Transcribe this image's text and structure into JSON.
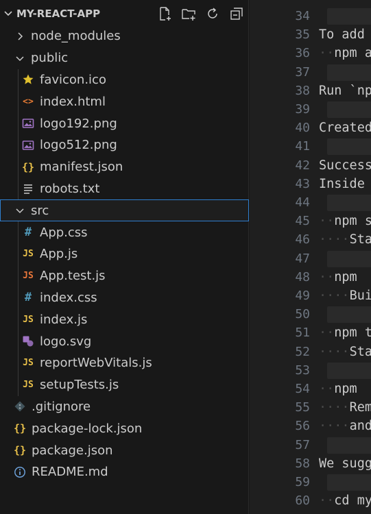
{
  "explorer": {
    "project_title": "MY-REACT-APP",
    "actions": [
      {
        "name": "new-file-icon",
        "title": "New File"
      },
      {
        "name": "new-folder-icon",
        "title": "New Folder"
      },
      {
        "name": "refresh-icon",
        "title": "Refresh Explorer"
      },
      {
        "name": "collapse-all-icon",
        "title": "Collapse Folders in Explorer"
      }
    ],
    "items": [
      {
        "label": "node_modules",
        "type": "folder-collapsed",
        "level": 0
      },
      {
        "label": "public",
        "type": "folder-expanded",
        "level": 0
      },
      {
        "label": "favicon.ico",
        "type": "file",
        "icon": "star-icon",
        "level": 1
      },
      {
        "label": "index.html",
        "type": "file",
        "icon": "html-icon",
        "level": 1
      },
      {
        "label": "logo192.png",
        "type": "file",
        "icon": "image-icon",
        "level": 1
      },
      {
        "label": "logo512.png",
        "type": "file",
        "icon": "image-icon",
        "level": 1
      },
      {
        "label": "manifest.json",
        "type": "file",
        "icon": "json-icon",
        "level": 1
      },
      {
        "label": "robots.txt",
        "type": "file",
        "icon": "text-lines-icon",
        "level": 1
      },
      {
        "label": "src",
        "type": "folder-expanded",
        "level": 0,
        "selected": true
      },
      {
        "label": "App.css",
        "type": "file",
        "icon": "css-hash-icon",
        "level": 1
      },
      {
        "label": "App.js",
        "type": "file",
        "icon": "js-icon",
        "level": 1
      },
      {
        "label": "App.test.js",
        "type": "file",
        "icon": "js-test-icon",
        "level": 1
      },
      {
        "label": "index.css",
        "type": "file",
        "icon": "css-hash-icon",
        "level": 1
      },
      {
        "label": "index.js",
        "type": "file",
        "icon": "js-icon",
        "level": 1
      },
      {
        "label": "logo.svg",
        "type": "file",
        "icon": "svg-icon",
        "level": 1
      },
      {
        "label": "reportWebVitals.js",
        "type": "file",
        "icon": "js-icon",
        "level": 1
      },
      {
        "label": "setupTests.js",
        "type": "file",
        "icon": "js-icon",
        "level": 1
      },
      {
        "label": ".gitignore",
        "type": "file",
        "icon": "git-icon",
        "level": 0
      },
      {
        "label": "package-lock.json",
        "type": "file",
        "icon": "json-icon",
        "level": 0
      },
      {
        "label": "package.json",
        "type": "file",
        "icon": "json-icon",
        "level": 0
      },
      {
        "label": "README.md",
        "type": "file",
        "icon": "info-icon",
        "level": 0
      }
    ],
    "glyphs": {
      "js": "JS",
      "json": "{}",
      "css": "#",
      "html": "<>"
    }
  },
  "editor": {
    "lines": [
      {
        "n": "34",
        "text": "",
        "blank_block": true
      },
      {
        "n": "35",
        "text": "To add"
      },
      {
        "n": "36",
        "text": "··npm a"
      },
      {
        "n": "37",
        "text": "",
        "blank_block": true
      },
      {
        "n": "38",
        "text": "Run `np"
      },
      {
        "n": "39",
        "text": "",
        "blank_block": true
      },
      {
        "n": "40",
        "text": "Created"
      },
      {
        "n": "41",
        "text": "",
        "blank_block": true
      },
      {
        "n": "42",
        "text": "Success"
      },
      {
        "n": "43",
        "text": "Inside"
      },
      {
        "n": "44",
        "text": "",
        "blank_block": true
      },
      {
        "n": "45",
        "text": "··npm s"
      },
      {
        "n": "46",
        "text": "····Sta"
      },
      {
        "n": "47",
        "text": "",
        "blank_block": true
      },
      {
        "n": "48",
        "text": "··npm"
      },
      {
        "n": "49",
        "text": "····Bui"
      },
      {
        "n": "50",
        "text": "",
        "blank_block": true
      },
      {
        "n": "51",
        "text": "··npm t"
      },
      {
        "n": "52",
        "text": "····Sta"
      },
      {
        "n": "53",
        "text": "",
        "blank_block": true
      },
      {
        "n": "54",
        "text": "··npm"
      },
      {
        "n": "55",
        "text": "····Rem"
      },
      {
        "n": "56",
        "text": "····and"
      },
      {
        "n": "57",
        "text": "",
        "blank_block": true
      },
      {
        "n": "58",
        "text": "We sugg"
      },
      {
        "n": "59",
        "text": "",
        "blank_block": true
      },
      {
        "n": "60",
        "text": "··cd my"
      }
    ]
  },
  "colors": {
    "js": "#e8c04a",
    "js_test": "#e8763a",
    "css": "#519aba",
    "html": "#e37933",
    "json": "#e8c04a",
    "image": "#a074c4",
    "svg": "#a074c4",
    "star": "#e0c02e",
    "git": "#41535b",
    "info": "#6ca0d8",
    "selection_border": "#2f7fd0"
  }
}
